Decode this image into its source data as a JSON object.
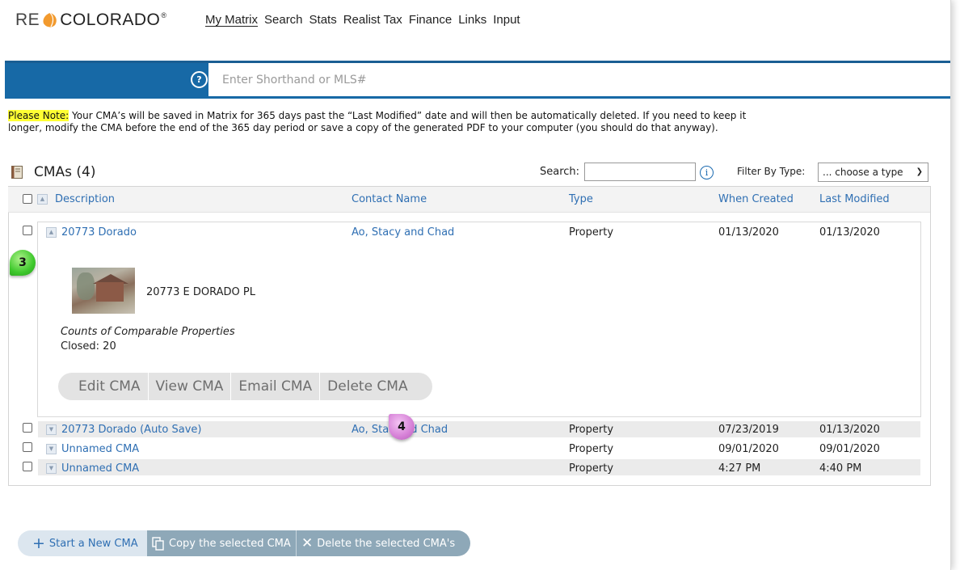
{
  "brand": {
    "logo_left": "RE",
    "logo_right": "COLORADO",
    "reg": "®"
  },
  "nav": [
    {
      "label": "My Matrix",
      "active": true
    },
    {
      "label": "Search"
    },
    {
      "label": "Stats"
    },
    {
      "label": "Realist Tax"
    },
    {
      "label": "Finance"
    },
    {
      "label": "Links"
    },
    {
      "label": "Input"
    }
  ],
  "shorthand": {
    "placeholder": "Enter Shorthand or MLS#",
    "help": "?"
  },
  "note": {
    "highlight": "Please Note:",
    "text": " Your CMA’s will be saved in Matrix for 365 days past the “Last Modified” date and will then be automatically deleted. If you need to keep it longer, modify the CMA before the end of the 365 day period or save a copy of the generated PDF to your computer (you should do that anyway)."
  },
  "cmas": {
    "title": "CMAs (4)",
    "search_label": "Search:",
    "filter_label": "Filter By Type:",
    "filter_value": "... choose a type"
  },
  "columns": {
    "description": "Description",
    "contact": "Contact Name",
    "type": "Type",
    "created": "When Created",
    "modified": "Last Modified"
  },
  "rows": [
    {
      "description": "20773 Dorado",
      "contact": "Ao, Stacy and Chad",
      "type": "Property",
      "created": "01/13/2020",
      "modified": "01/13/2020"
    },
    {
      "description": "20773 Dorado (Auto Save)",
      "contact_a": "Ao, Sta",
      "contact_b": "d Chad",
      "type": "Property",
      "created": "07/23/2019",
      "modified": "01/13/2020"
    },
    {
      "description": "Unnamed CMA",
      "contact": "",
      "type": "Property",
      "created": "09/01/2020",
      "modified": "09/01/2020"
    },
    {
      "description": "Unnamed CMA",
      "contact": "",
      "type": "Property",
      "created": "4:27 PM",
      "modified": "4:40 PM"
    }
  ],
  "detail": {
    "address": "20773 E DORADO PL",
    "counts_label": "Counts of Comparable Properties",
    "closed": "Closed: 20",
    "actions": [
      "Edit CMA",
      "View CMA",
      "Email CMA",
      "Delete CMA"
    ]
  },
  "badges": {
    "step3": "3",
    "step4": "4"
  },
  "bottom": {
    "new": "Start a New CMA",
    "copy": "Copy the selected CMA",
    "delete": "Delete the selected CMA's"
  }
}
